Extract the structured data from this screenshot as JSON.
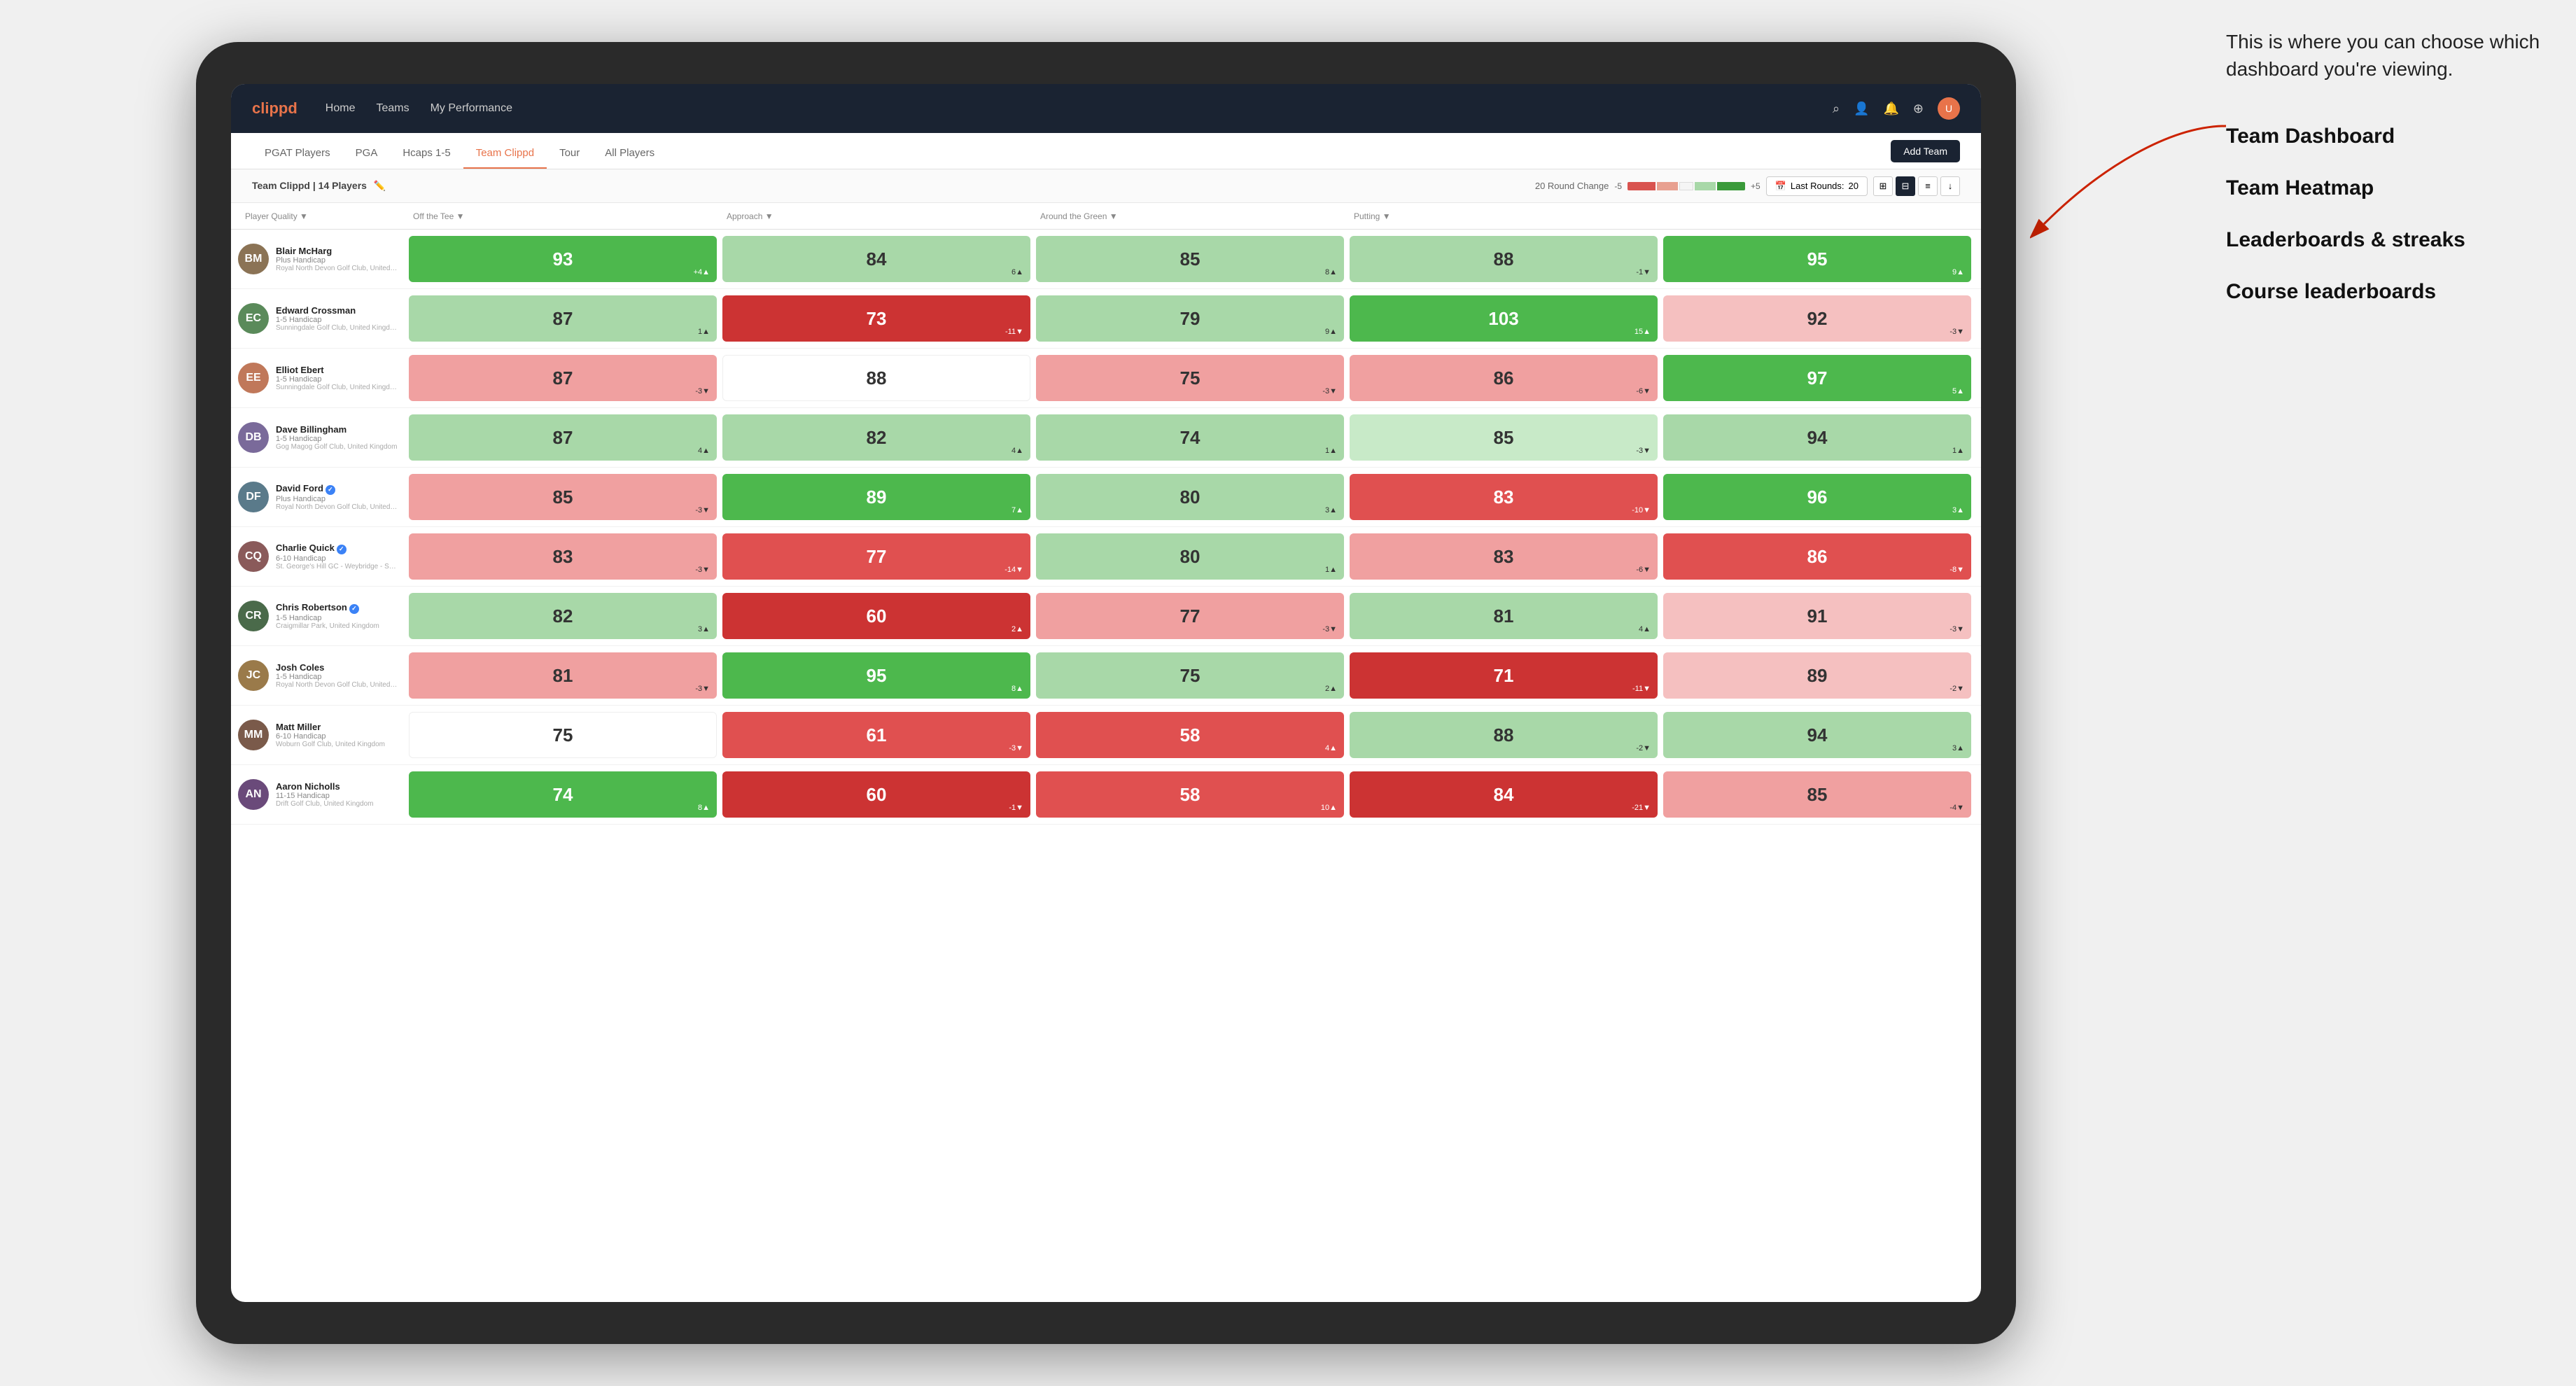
{
  "annotation": {
    "callout": "This is where you can choose which dashboard you're viewing.",
    "items": [
      {
        "label": "Team Dashboard"
      },
      {
        "label": "Team Heatmap"
      },
      {
        "label": "Leaderboards & streaks"
      },
      {
        "label": "Course leaderboards"
      }
    ]
  },
  "navbar": {
    "logo": "clippd",
    "links": [
      {
        "label": "Home",
        "active": false
      },
      {
        "label": "Teams",
        "active": false
      },
      {
        "label": "My Performance",
        "active": false
      }
    ],
    "icons": [
      "search",
      "user",
      "bell",
      "settings",
      "avatar"
    ]
  },
  "tabbar": {
    "tabs": [
      {
        "label": "PGAT Players",
        "active": false
      },
      {
        "label": "PGA",
        "active": false
      },
      {
        "label": "Hcaps 1-5",
        "active": false
      },
      {
        "label": "Team Clippd",
        "active": true
      },
      {
        "label": "Tour",
        "active": false
      },
      {
        "label": "All Players",
        "active": false
      }
    ],
    "add_team_label": "Add Team"
  },
  "toolbar": {
    "team_label": "Team Clippd",
    "player_count": "14 Players",
    "round_change_label": "20 Round Change",
    "change_low": "-5",
    "change_high": "+5",
    "last_rounds_label": "Last Rounds:",
    "last_rounds_value": "20",
    "view_modes": [
      "grid-small",
      "grid-large",
      "table",
      "download"
    ]
  },
  "table": {
    "columns": [
      {
        "label": "Player Quality ▼"
      },
      {
        "label": "Off the Tee ▼"
      },
      {
        "label": "Approach ▼"
      },
      {
        "label": "Around the Green ▼"
      },
      {
        "label": "Putting ▼"
      }
    ],
    "players": [
      {
        "name": "Blair McHarg",
        "handicap": "Plus Handicap",
        "club": "Royal North Devon Golf Club, United Kingdom",
        "avatar_color": "#8B7355",
        "initials": "BM",
        "scores": [
          {
            "value": 93,
            "change": "+4",
            "dir": "up",
            "color": "c-green-mid"
          },
          {
            "value": 84,
            "change": "6",
            "dir": "up",
            "color": "c-green-light"
          },
          {
            "value": 85,
            "change": "8",
            "dir": "up",
            "color": "c-green-light"
          },
          {
            "value": 88,
            "change": "-1",
            "dir": "down",
            "color": "c-green-light"
          },
          {
            "value": 95,
            "change": "9",
            "dir": "up",
            "color": "c-green-mid"
          }
        ]
      },
      {
        "name": "Edward Crossman",
        "handicap": "1-5 Handicap",
        "club": "Sunningdale Golf Club, United Kingdom",
        "avatar_color": "#5a8a5a",
        "initials": "EC",
        "scores": [
          {
            "value": 87,
            "change": "1",
            "dir": "up",
            "color": "c-green-light"
          },
          {
            "value": 73,
            "change": "-11",
            "dir": "down",
            "color": "c-red-dark"
          },
          {
            "value": 79,
            "change": "9",
            "dir": "up",
            "color": "c-green-light"
          },
          {
            "value": 103,
            "change": "15",
            "dir": "up",
            "color": "c-green-mid"
          },
          {
            "value": 92,
            "change": "-3",
            "dir": "down",
            "color": "c-red-pale"
          }
        ]
      },
      {
        "name": "Elliot Ebert",
        "handicap": "1-5 Handicap",
        "club": "Sunningdale Golf Club, United Kingdom",
        "avatar_color": "#c0785a",
        "initials": "EE",
        "scores": [
          {
            "value": 87,
            "change": "-3",
            "dir": "down",
            "color": "c-red-light"
          },
          {
            "value": 88,
            "change": "",
            "dir": "",
            "color": "c-white"
          },
          {
            "value": 75,
            "change": "-3",
            "dir": "down",
            "color": "c-red-light"
          },
          {
            "value": 86,
            "change": "-6",
            "dir": "down",
            "color": "c-red-light"
          },
          {
            "value": 97,
            "change": "5",
            "dir": "up",
            "color": "c-green-mid"
          }
        ]
      },
      {
        "name": "Dave Billingham",
        "handicap": "1-5 Handicap",
        "club": "Gog Magog Golf Club, United Kingdom",
        "avatar_color": "#7a6a9a",
        "initials": "DB",
        "scores": [
          {
            "value": 87,
            "change": "4",
            "dir": "up",
            "color": "c-green-light"
          },
          {
            "value": 82,
            "change": "4",
            "dir": "up",
            "color": "c-green-light"
          },
          {
            "value": 74,
            "change": "1",
            "dir": "up",
            "color": "c-green-light"
          },
          {
            "value": 85,
            "change": "-3",
            "dir": "down",
            "color": "c-green-pale"
          },
          {
            "value": 94,
            "change": "1",
            "dir": "up",
            "color": "c-green-light"
          }
        ]
      },
      {
        "name": "David Ford",
        "handicap": "Plus Handicap",
        "club": "Royal North Devon Golf Club, United Kingdom",
        "avatar_color": "#5a7a8a",
        "initials": "DF",
        "verified": true,
        "scores": [
          {
            "value": 85,
            "change": "-3",
            "dir": "down",
            "color": "c-red-light"
          },
          {
            "value": 89,
            "change": "7",
            "dir": "up",
            "color": "c-green-mid"
          },
          {
            "value": 80,
            "change": "3",
            "dir": "up",
            "color": "c-green-light"
          },
          {
            "value": 83,
            "change": "-10",
            "dir": "down",
            "color": "c-red-mid"
          },
          {
            "value": 96,
            "change": "3",
            "dir": "up",
            "color": "c-green-mid"
          }
        ]
      },
      {
        "name": "Charlie Quick",
        "handicap": "6-10 Handicap",
        "club": "St. George's Hill GC - Weybridge - Surrey, Uni...",
        "avatar_color": "#8a5a5a",
        "initials": "CQ",
        "verified": true,
        "scores": [
          {
            "value": 83,
            "change": "-3",
            "dir": "down",
            "color": "c-red-light"
          },
          {
            "value": 77,
            "change": "-14",
            "dir": "down",
            "color": "c-red-mid"
          },
          {
            "value": 80,
            "change": "1",
            "dir": "up",
            "color": "c-green-light"
          },
          {
            "value": 83,
            "change": "-6",
            "dir": "down",
            "color": "c-red-light"
          },
          {
            "value": 86,
            "change": "-8",
            "dir": "down",
            "color": "c-red-mid"
          }
        ]
      },
      {
        "name": "Chris Robertson",
        "handicap": "1-5 Handicap",
        "club": "Craigmillar Park, United Kingdom",
        "avatar_color": "#4a6a4a",
        "initials": "CR",
        "verified": true,
        "scores": [
          {
            "value": 82,
            "change": "3",
            "dir": "up",
            "color": "c-green-light"
          },
          {
            "value": 60,
            "change": "2",
            "dir": "up",
            "color": "c-red-dark"
          },
          {
            "value": 77,
            "change": "-3",
            "dir": "down",
            "color": "c-red-light"
          },
          {
            "value": 81,
            "change": "4",
            "dir": "up",
            "color": "c-green-light"
          },
          {
            "value": 91,
            "change": "-3",
            "dir": "down",
            "color": "c-red-pale"
          }
        ]
      },
      {
        "name": "Josh Coles",
        "handicap": "1-5 Handicap",
        "club": "Royal North Devon Golf Club, United Kingdom",
        "avatar_color": "#9a7a4a",
        "initials": "JC",
        "scores": [
          {
            "value": 81,
            "change": "-3",
            "dir": "down",
            "color": "c-red-light"
          },
          {
            "value": 95,
            "change": "8",
            "dir": "up",
            "color": "c-green-mid"
          },
          {
            "value": 75,
            "change": "2",
            "dir": "up",
            "color": "c-green-light"
          },
          {
            "value": 71,
            "change": "-11",
            "dir": "down",
            "color": "c-red-dark"
          },
          {
            "value": 89,
            "change": "-2",
            "dir": "down",
            "color": "c-red-pale"
          }
        ]
      },
      {
        "name": "Matt Miller",
        "handicap": "6-10 Handicap",
        "club": "Woburn Golf Club, United Kingdom",
        "avatar_color": "#7a5a4a",
        "initials": "MM",
        "scores": [
          {
            "value": 75,
            "change": "",
            "dir": "",
            "color": "c-white"
          },
          {
            "value": 61,
            "change": "-3",
            "dir": "down",
            "color": "c-red-mid"
          },
          {
            "value": 58,
            "change": "4",
            "dir": "up",
            "color": "c-red-mid"
          },
          {
            "value": 88,
            "change": "-2",
            "dir": "down",
            "color": "c-green-light"
          },
          {
            "value": 94,
            "change": "3",
            "dir": "up",
            "color": "c-green-light"
          }
        ]
      },
      {
        "name": "Aaron Nicholls",
        "handicap": "11-15 Handicap",
        "club": "Drift Golf Club, United Kingdom",
        "avatar_color": "#6a4a7a",
        "initials": "AN",
        "scores": [
          {
            "value": 74,
            "change": "8",
            "dir": "up",
            "color": "c-green-mid"
          },
          {
            "value": 60,
            "change": "-1",
            "dir": "down",
            "color": "c-red-dark"
          },
          {
            "value": 58,
            "change": "10",
            "dir": "up",
            "color": "c-red-mid"
          },
          {
            "value": 84,
            "change": "-21",
            "dir": "down",
            "color": "c-red-dark"
          },
          {
            "value": 85,
            "change": "-4",
            "dir": "down",
            "color": "c-red-light"
          }
        ]
      }
    ]
  }
}
